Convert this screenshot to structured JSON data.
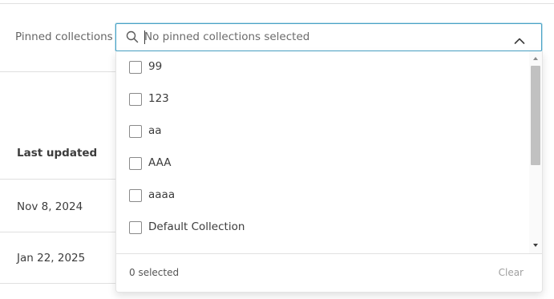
{
  "filter": {
    "label": "Pinned collections",
    "placeholder": "No pinned collections selected",
    "value": ""
  },
  "options": [
    {
      "label": "99",
      "checked": false
    },
    {
      "label": "123",
      "checked": false
    },
    {
      "label": "aa",
      "checked": false
    },
    {
      "label": "AAA",
      "checked": false
    },
    {
      "label": "aaaa",
      "checked": false
    },
    {
      "label": "Default Collection",
      "checked": false
    }
  ],
  "footer": {
    "selected_count": "0 selected",
    "clear_label": "Clear"
  },
  "table": {
    "column_header": "Last updated",
    "rows": [
      "Nov 8, 2024",
      "Jan 22, 2025"
    ]
  },
  "colors": {
    "focus_border": "#4aa3c6",
    "text": "#3c3c3c",
    "muted": "#a0a0a0"
  }
}
